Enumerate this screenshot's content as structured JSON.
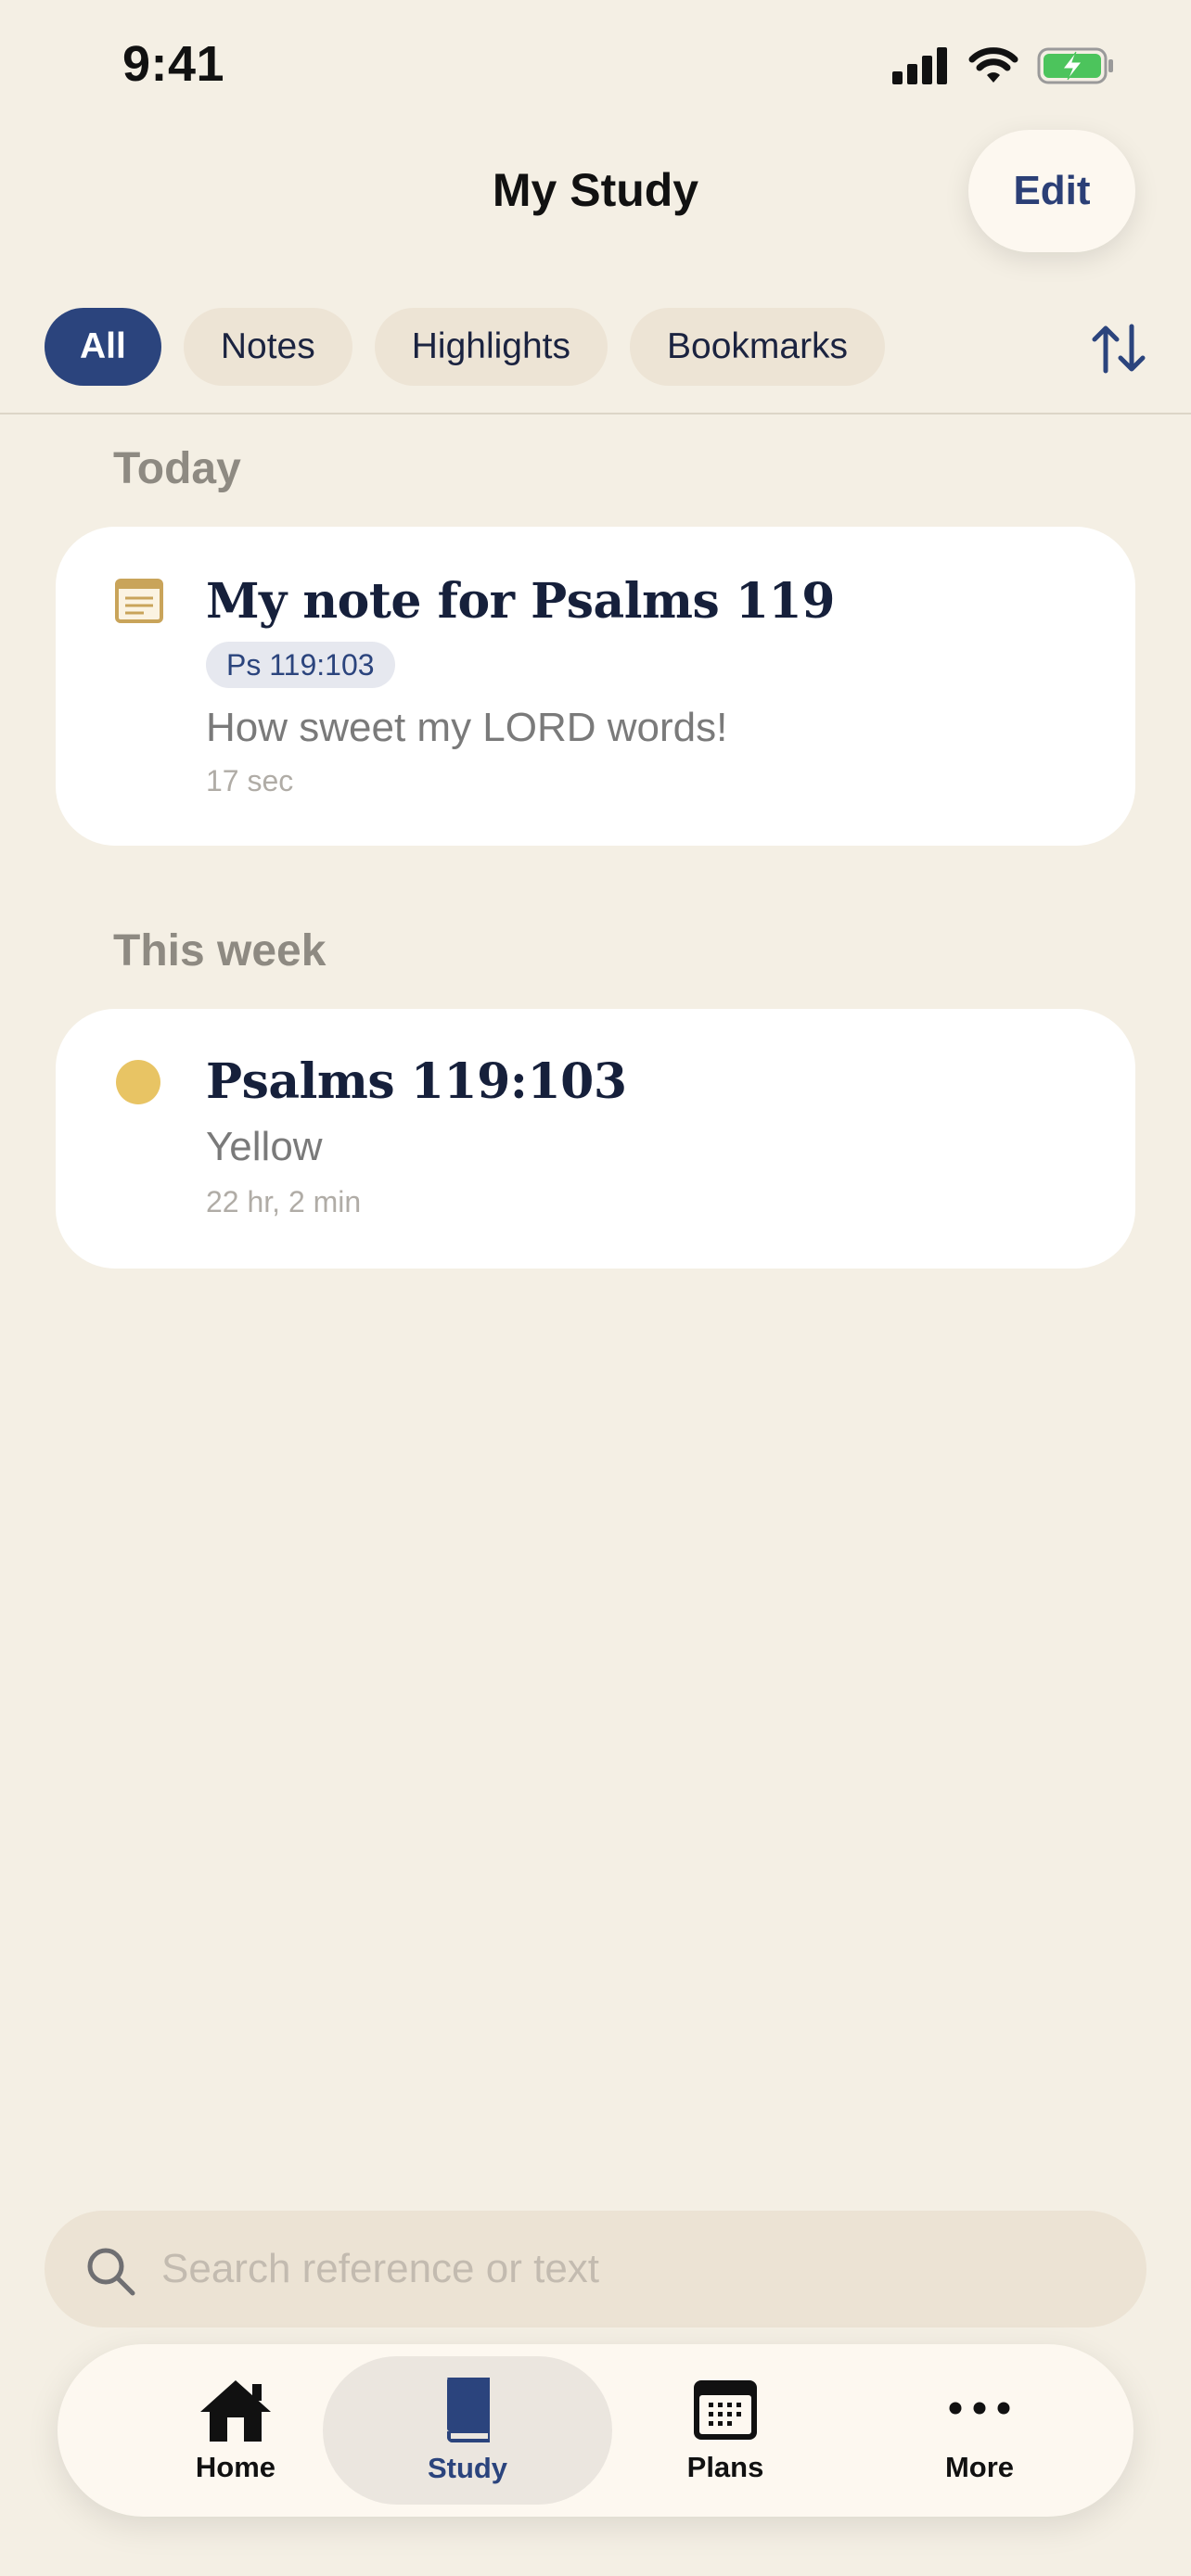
{
  "status_bar": {
    "time": "9:41"
  },
  "header": {
    "title": "My Study",
    "edit_label": "Edit"
  },
  "filters": [
    {
      "label": "All",
      "active": true
    },
    {
      "label": "Notes",
      "active": false
    },
    {
      "label": "Highlights",
      "active": false
    },
    {
      "label": "Bookmarks",
      "active": false
    }
  ],
  "sections": [
    {
      "label": "Today",
      "item": {
        "icon": "note-icon",
        "title": "My note for Psalms 119",
        "reference": "Ps 119:103",
        "text": "How sweet my LORD words!",
        "time": "17 sec"
      }
    },
    {
      "label": "This week",
      "item": {
        "icon": "highlight-dot-icon",
        "title": "Psalms 119:103",
        "text": "Yellow",
        "time": "22 hr, 2 min",
        "color": "#e8c464"
      }
    }
  ],
  "search": {
    "placeholder": "Search reference or text"
  },
  "tabs": [
    {
      "label": "Home",
      "icon": "home-icon"
    },
    {
      "label": "Study",
      "icon": "book-icon",
      "active": true
    },
    {
      "label": "Plans",
      "icon": "calendar-icon"
    },
    {
      "label": "More",
      "icon": "ellipsis-icon"
    }
  ],
  "colors": {
    "background": "#f4efe4",
    "accent": "#2b447d",
    "highlight_yellow": "#e8c464",
    "note_icon": "#c9a45a"
  }
}
